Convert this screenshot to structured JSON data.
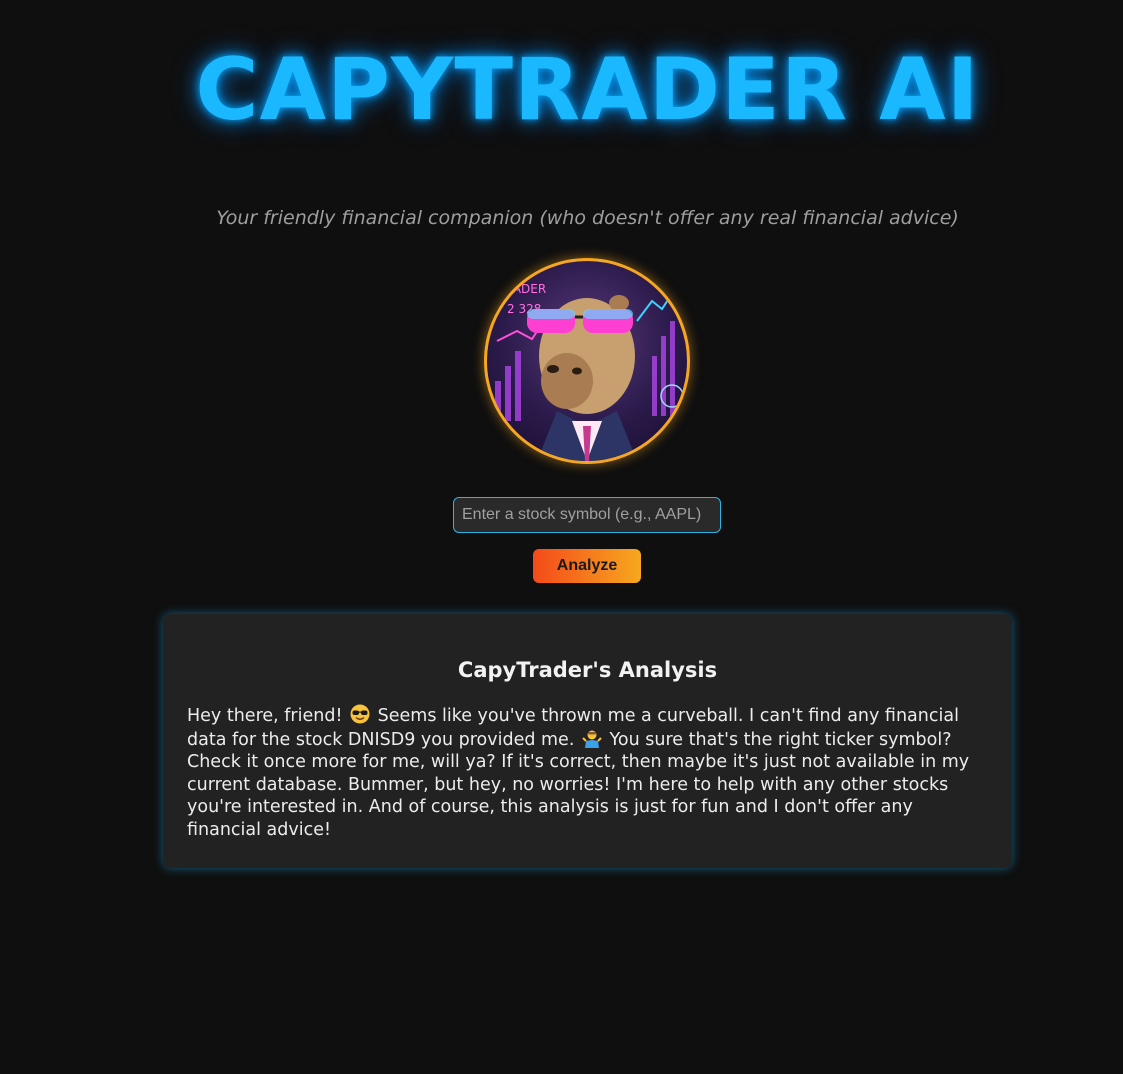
{
  "header": {
    "title": "CAPYTRADER AI",
    "subtitle": "Your friendly financial companion (who doesn't offer any real financial advice)"
  },
  "avatar": {
    "icon": "capybara-avatar-icon",
    "border_color": "#f5a623",
    "badge_text": "RADER",
    "badge_number": "2 328"
  },
  "search": {
    "placeholder": "Enter a stock symbol (e.g., AAPL)",
    "value": ""
  },
  "actions": {
    "analyze_label": "Analyze"
  },
  "analysis": {
    "title": "CapyTrader's Analysis",
    "text_part1": "Hey there, friend!",
    "emoji1": "sunglasses-emoji-icon",
    "text_part2": "Seems like you've thrown me a curveball. I can't find any financial data for the stock DNISD9 you provided me.",
    "emoji2": "person-shrugging-emoji-icon",
    "text_part3": "You sure that's the right ticker symbol? Check it once more for me, will ya? If it's correct, then maybe it's just not available in my current database. Bummer, but hey, no worries! I'm here to help with any other stocks you're interested in. And of course, this analysis is just for fun and I don't offer any financial advice!"
  },
  "colors": {
    "background": "#0f0f0f",
    "title_glow": "#1ab8ff",
    "card_background": "#222222",
    "button_gradient_start": "#f34a1a",
    "button_gradient_end": "#f7a81f"
  }
}
